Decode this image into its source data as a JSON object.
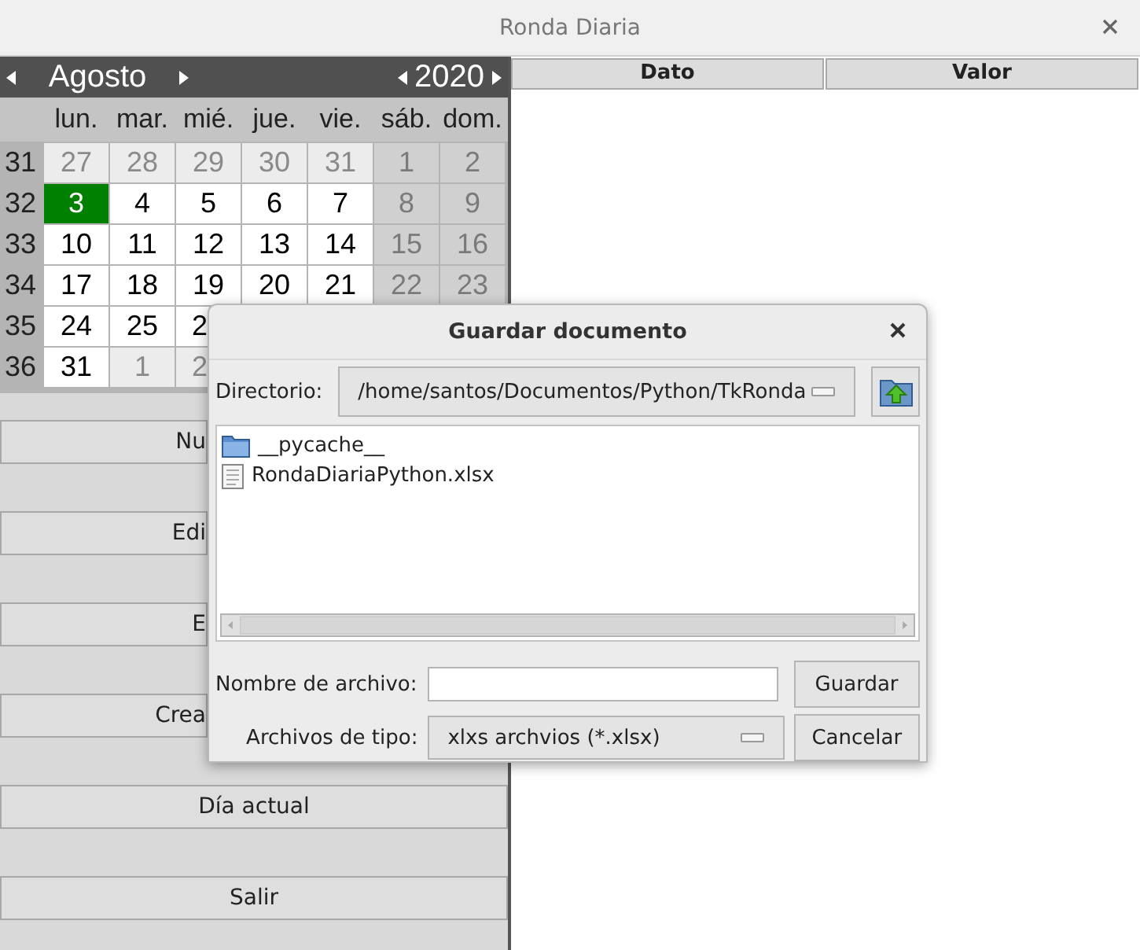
{
  "window": {
    "title": "Ronda Diaria"
  },
  "calendar": {
    "month": "Agosto",
    "year": "2020",
    "weekdays": [
      "lun.",
      "mar.",
      "mié.",
      "jue.",
      "vie.",
      "sáb.",
      "dom."
    ],
    "weeks": [
      {
        "number": "31",
        "days": [
          {
            "label": "27",
            "kind": "outside",
            "selected": false
          },
          {
            "label": "28",
            "kind": "outside",
            "selected": false
          },
          {
            "label": "29",
            "kind": "outside",
            "selected": false
          },
          {
            "label": "30",
            "kind": "outside",
            "selected": false
          },
          {
            "label": "31",
            "kind": "outside",
            "selected": false
          },
          {
            "label": "1",
            "kind": "weekend",
            "selected": false
          },
          {
            "label": "2",
            "kind": "weekend",
            "selected": false
          }
        ]
      },
      {
        "number": "32",
        "days": [
          {
            "label": "3",
            "kind": "normal",
            "selected": true
          },
          {
            "label": "4",
            "kind": "normal",
            "selected": false
          },
          {
            "label": "5",
            "kind": "normal",
            "selected": false
          },
          {
            "label": "6",
            "kind": "normal",
            "selected": false
          },
          {
            "label": "7",
            "kind": "normal",
            "selected": false
          },
          {
            "label": "8",
            "kind": "weekend",
            "selected": false
          },
          {
            "label": "9",
            "kind": "weekend",
            "selected": false
          }
        ]
      },
      {
        "number": "33",
        "days": [
          {
            "label": "10",
            "kind": "normal",
            "selected": false
          },
          {
            "label": "11",
            "kind": "normal",
            "selected": false
          },
          {
            "label": "12",
            "kind": "normal",
            "selected": false
          },
          {
            "label": "13",
            "kind": "normal",
            "selected": false
          },
          {
            "label": "14",
            "kind": "normal",
            "selected": false
          },
          {
            "label": "15",
            "kind": "weekend",
            "selected": false
          },
          {
            "label": "16",
            "kind": "weekend",
            "selected": false
          }
        ]
      },
      {
        "number": "34",
        "days": [
          {
            "label": "17",
            "kind": "normal",
            "selected": false
          },
          {
            "label": "18",
            "kind": "normal",
            "selected": false
          },
          {
            "label": "19",
            "kind": "normal",
            "selected": false
          },
          {
            "label": "20",
            "kind": "normal",
            "selected": false
          },
          {
            "label": "21",
            "kind": "normal",
            "selected": false
          },
          {
            "label": "22",
            "kind": "weekend",
            "selected": false
          },
          {
            "label": "23",
            "kind": "weekend",
            "selected": false
          }
        ]
      },
      {
        "number": "35",
        "days": [
          {
            "label": "24",
            "kind": "normal",
            "selected": false
          },
          {
            "label": "25",
            "kind": "normal",
            "selected": false
          },
          {
            "label": "2",
            "kind": "normal",
            "selected": false
          }
        ]
      },
      {
        "number": "36",
        "days": [
          {
            "label": "31",
            "kind": "normal",
            "selected": false
          },
          {
            "label": "1",
            "kind": "outside",
            "selected": false
          },
          {
            "label": "2",
            "kind": "outside",
            "selected": false
          }
        ]
      }
    ]
  },
  "buttons": [
    "Nu",
    "Edi",
    "E",
    "Crea",
    "Día actual",
    "Salir"
  ],
  "table": {
    "columns": [
      "Dato",
      "Valor"
    ]
  },
  "dialog": {
    "title": "Guardar documento",
    "directory": {
      "label": "Directorio:",
      "value": "/home/santos/Documentos/Python/TkRonda"
    },
    "files": [
      {
        "name": "__pycache__",
        "kind": "folder"
      },
      {
        "name": "RondaDiariaPython.xlsx",
        "kind": "file"
      }
    ],
    "filename": {
      "label": "Nombre de archivo:"
    },
    "filetype": {
      "label": "Archivos de tipo:",
      "value": "xlxs archvios (*.xlsx)"
    },
    "actions": [
      {
        "label": "Guardar"
      },
      {
        "label": "Cancelar"
      }
    ]
  }
}
